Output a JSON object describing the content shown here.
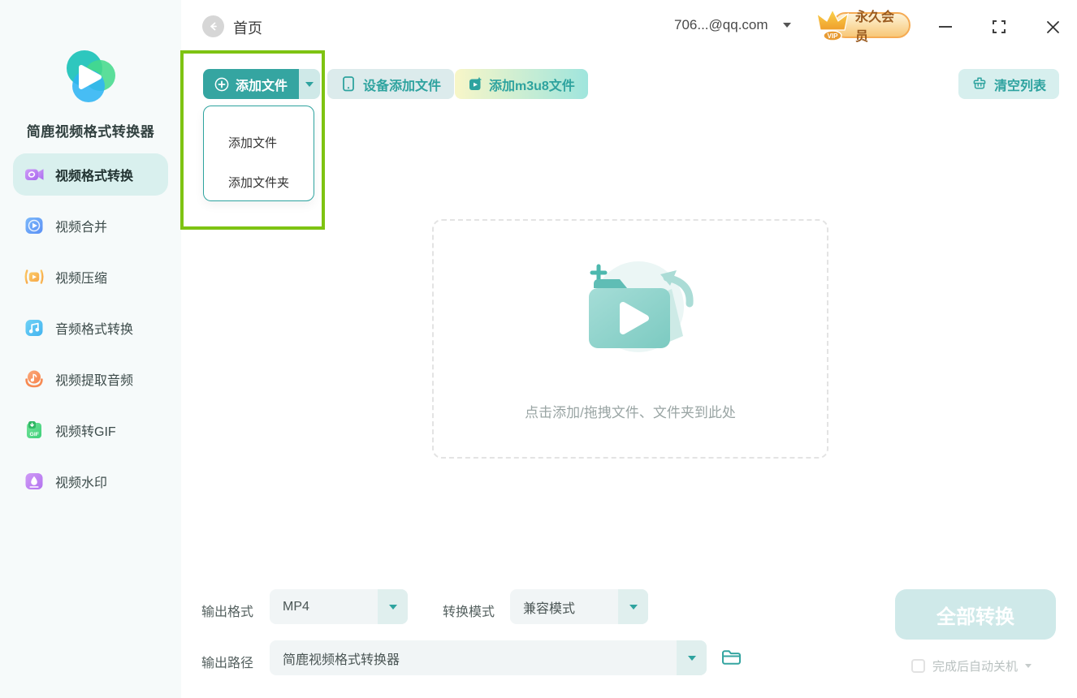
{
  "window": {
    "home": "首页",
    "account": "706...@qq.com",
    "vip_label": "永久会员",
    "vip_tag": "VIP"
  },
  "app": {
    "name": "简鹿视频格式转换器"
  },
  "sidebar": {
    "items": [
      {
        "label": "视频格式转换",
        "icon": "video-convert-icon",
        "active": true
      },
      {
        "label": "视频合并",
        "icon": "video-merge-icon",
        "active": false
      },
      {
        "label": "视频压缩",
        "icon": "video-compress-icon",
        "active": false
      },
      {
        "label": "音频格式转换",
        "icon": "audio-convert-icon",
        "active": false
      },
      {
        "label": "视频提取音频",
        "icon": "extract-audio-icon",
        "active": false
      },
      {
        "label": "视频转GIF",
        "icon": "video-to-gif-icon",
        "active": false
      },
      {
        "label": "视频水印",
        "icon": "watermark-icon",
        "active": false
      }
    ]
  },
  "toolbar": {
    "add_file": "添加文件",
    "device_add": "设备添加文件",
    "add_m3u8": "添加m3u8文件",
    "clear_list": "清空列表"
  },
  "add_menu": {
    "items": [
      {
        "label": "添加文件"
      },
      {
        "label": "添加文件夹"
      }
    ]
  },
  "dropzone": {
    "hint": "点击添加/拖拽文件、文件夹到此处"
  },
  "output": {
    "format_label": "输出格式",
    "format_value": "MP4",
    "mode_label": "转换模式",
    "mode_value": "兼容模式",
    "path_label": "输出路径",
    "path_value": "简鹿视频格式转换器"
  },
  "actions": {
    "convert_all": "全部转换",
    "auto_shutdown": "完成后自动关机"
  },
  "colors": {
    "primary_teal": "#35a5a1",
    "teal_text": "#2ea39f",
    "light_teal_bg": "#d9f0ee",
    "annotation_green": "#7ec312",
    "vip_text": "#9a5b20",
    "sidebar_bg": "#f6fafa"
  }
}
